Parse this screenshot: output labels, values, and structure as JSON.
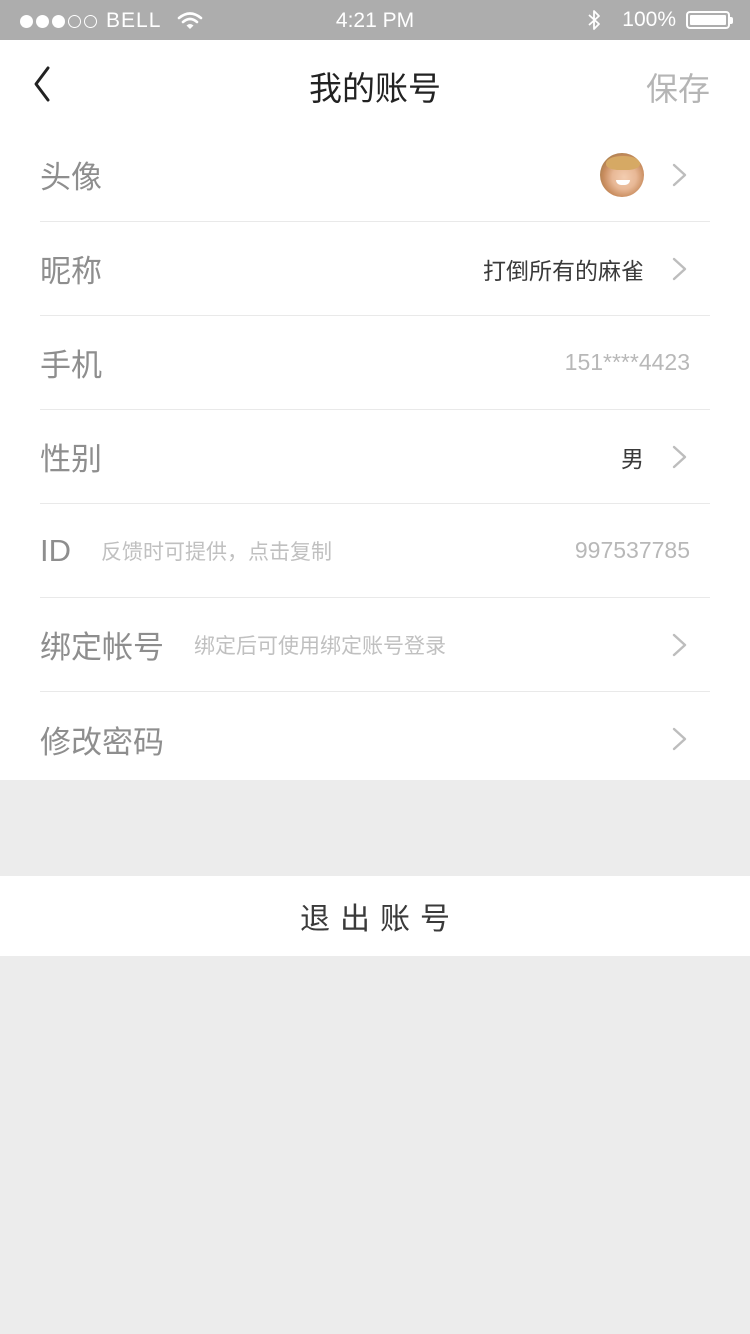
{
  "status_bar": {
    "carrier": "BELL",
    "time": "4:21 PM",
    "battery": "100%",
    "signal_bars_filled": 3,
    "signal_bars_total": 5
  },
  "nav": {
    "title": "我的账号",
    "save_label": "保存",
    "back_icon": "chevron-left-icon"
  },
  "rows": {
    "avatar": {
      "label": "头像"
    },
    "nickname": {
      "label": "昵称",
      "value": "打倒所有的麻雀"
    },
    "phone": {
      "label": "手机",
      "value": "151****4423"
    },
    "gender": {
      "label": "性别",
      "value": "男"
    },
    "id": {
      "label": "ID",
      "hint": "反馈时可提供，点击复制",
      "value": "997537785"
    },
    "bind": {
      "label": "绑定帐号",
      "hint": "绑定后可使用绑定账号登录"
    },
    "password": {
      "label": "修改密码"
    }
  },
  "logout": {
    "label": "退出账号"
  },
  "colors": {
    "status_bar": "#adadad",
    "background": "#ececec",
    "label": "#8e8e8e",
    "hint": "#c0c0c0"
  }
}
